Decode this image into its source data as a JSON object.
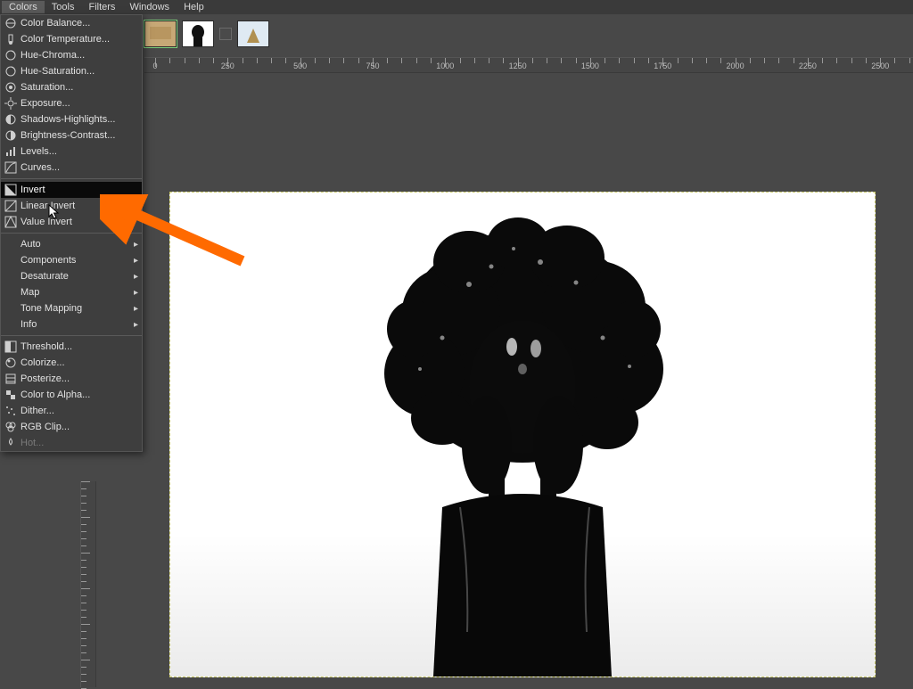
{
  "menubar": {
    "items": [
      "Colors",
      "Tools",
      "Filters",
      "Windows",
      "Help"
    ],
    "active_index": 0
  },
  "dropdown": {
    "groups": [
      [
        {
          "icon": "balance",
          "label": "Color Balance..."
        },
        {
          "icon": "temp",
          "label": "Color Temperature..."
        },
        {
          "icon": "hue",
          "label": "Hue-Chroma..."
        },
        {
          "icon": "hue",
          "label": "Hue-Saturation..."
        },
        {
          "icon": "sat",
          "label": "Saturation..."
        },
        {
          "icon": "expo",
          "label": "Exposure..."
        },
        {
          "icon": "shadow",
          "label": "Shadows-Highlights..."
        },
        {
          "icon": "bright",
          "label": "Brightness-Contrast..."
        },
        {
          "icon": "levels",
          "label": "Levels..."
        },
        {
          "icon": "curves",
          "label": "Curves..."
        }
      ],
      [
        {
          "icon": "invert",
          "label": "Invert",
          "highlight": true
        },
        {
          "icon": "linvert",
          "label": "Linear Invert"
        },
        {
          "icon": "vinvert",
          "label": "Value Invert"
        }
      ],
      [
        {
          "icon": "",
          "label": "Auto",
          "submenu": true
        },
        {
          "icon": "",
          "label": "Components",
          "submenu": true
        },
        {
          "icon": "",
          "label": "Desaturate",
          "submenu": true
        },
        {
          "icon": "",
          "label": "Map",
          "submenu": true
        },
        {
          "icon": "",
          "label": "Tone Mapping",
          "submenu": true
        },
        {
          "icon": "",
          "label": "Info",
          "submenu": true
        }
      ],
      [
        {
          "icon": "thresh",
          "label": "Threshold..."
        },
        {
          "icon": "colorize",
          "label": "Colorize..."
        },
        {
          "icon": "poster",
          "label": "Posterize..."
        },
        {
          "icon": "alpha",
          "label": "Color to Alpha..."
        },
        {
          "icon": "dither",
          "label": "Dither..."
        },
        {
          "icon": "rgb",
          "label": "RGB Clip..."
        },
        {
          "icon": "hot",
          "label": "Hot...",
          "disabled": true
        }
      ]
    ]
  },
  "ruler": {
    "h_labels": [
      "0",
      "250",
      "500",
      "750",
      "1000",
      "1250",
      "1500",
      "1750",
      "2000",
      "2250",
      "2500"
    ]
  },
  "thumbs": {
    "count": 3
  },
  "annotation": {
    "arrow_color": "#ff6a00"
  }
}
